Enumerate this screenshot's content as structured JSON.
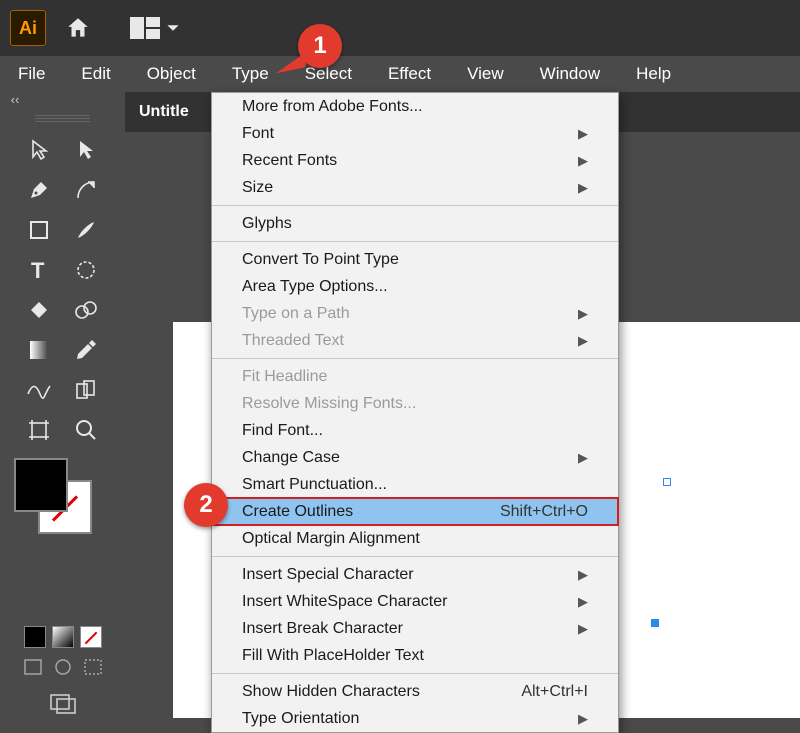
{
  "menubar": {
    "items": [
      "File",
      "Edit",
      "Object",
      "Type",
      "Select",
      "Effect",
      "View",
      "Window",
      "Help"
    ]
  },
  "tab": {
    "title": "Untitle"
  },
  "callouts": {
    "one": "1",
    "two": "2"
  },
  "type_menu": {
    "groups": [
      [
        {
          "label": "More from Adobe Fonts...",
          "submenu": false
        },
        {
          "label": "Font",
          "submenu": true
        },
        {
          "label": "Recent Fonts",
          "submenu": true
        },
        {
          "label": "Size",
          "submenu": true
        }
      ],
      [
        {
          "label": "Glyphs",
          "submenu": false
        }
      ],
      [
        {
          "label": "Convert To Point Type",
          "submenu": false
        },
        {
          "label": "Area Type Options...",
          "submenu": false
        },
        {
          "label": "Type on a Path",
          "submenu": true,
          "disabled": true
        },
        {
          "label": "Threaded Text",
          "submenu": true,
          "disabled": true
        }
      ],
      [
        {
          "label": "Fit Headline",
          "submenu": false,
          "disabled": true
        },
        {
          "label": "Resolve Missing Fonts...",
          "submenu": false,
          "disabled": true
        },
        {
          "label": "Find Font...",
          "submenu": false
        },
        {
          "label": "Change Case",
          "submenu": true
        },
        {
          "label": "Smart Punctuation...",
          "submenu": false
        },
        {
          "label": "Create Outlines",
          "submenu": false,
          "shortcut": "Shift+Ctrl+O",
          "highlight": true,
          "boxed": true
        },
        {
          "label": "Optical Margin Alignment",
          "submenu": false
        }
      ],
      [
        {
          "label": "Insert Special Character",
          "submenu": true
        },
        {
          "label": "Insert WhiteSpace Character",
          "submenu": true
        },
        {
          "label": "Insert Break Character",
          "submenu": true
        },
        {
          "label": "Fill With PlaceHolder Text",
          "submenu": false
        }
      ],
      [
        {
          "label": "Show Hidden Characters",
          "submenu": false,
          "shortcut": "Alt+Ctrl+I"
        },
        {
          "label": "Type Orientation",
          "submenu": true
        }
      ]
    ]
  },
  "tools": [
    "selection",
    "direct-selection",
    "pen",
    "curvature",
    "rectangle",
    "paintbrush",
    "type",
    "rotate",
    "shape-builder",
    "live-paint",
    "gradient",
    "eyedropper",
    "blend",
    "symbol-sprayer",
    "artboard",
    "zoom"
  ]
}
